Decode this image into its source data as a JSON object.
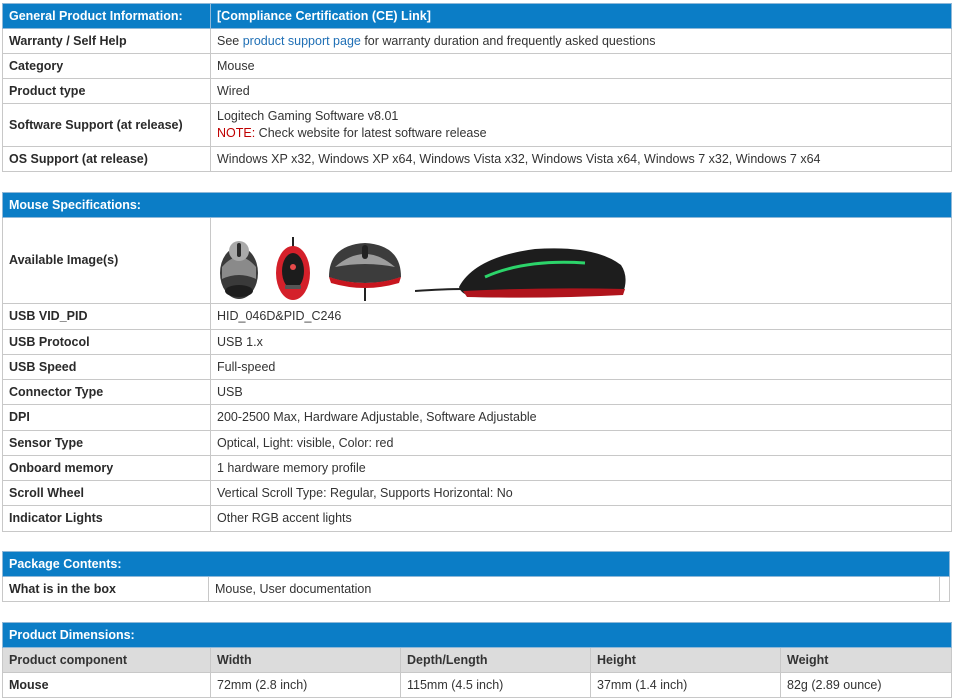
{
  "general": {
    "header_label": "General Product Information:",
    "header_link": "[Compliance Certification (CE) Link]",
    "rows": {
      "warranty": {
        "label": "Warranty / Self Help",
        "pre": "See ",
        "link": "product support page",
        "post": " for warranty duration and frequently asked questions"
      },
      "category": {
        "label": "Category",
        "value": "Mouse"
      },
      "product_type": {
        "label": "Product type",
        "value": "Wired"
      },
      "software": {
        "label": "Software Support (at release)",
        "value": "Logitech Gaming Software v8.01",
        "note_prefix": "NOTE:",
        "note_text": " Check website for latest software release"
      },
      "os": {
        "label": "OS Support (at release)",
        "value": "Windows XP x32, Windows XP x64, Windows Vista x32, Windows Vista x64, Windows 7 x32, Windows 7 x64"
      }
    }
  },
  "mouse_specs": {
    "header": "Mouse Specifications:",
    "images_label": "Available Image(s)",
    "images": [
      "mouse-front-image",
      "mouse-bottom-image",
      "mouse-top-image",
      "mouse-side-image"
    ],
    "rows": [
      {
        "label": "USB VID_PID",
        "value": "HID_046D&PID_C246"
      },
      {
        "label": "USB Protocol",
        "value": "USB 1.x"
      },
      {
        "label": "USB Speed",
        "value": "Full-speed"
      },
      {
        "label": "Connector Type",
        "value": "USB"
      },
      {
        "label": "DPI",
        "value": "200-2500 Max, Hardware Adjustable, Software Adjustable"
      },
      {
        "label": "Sensor Type",
        "value": "Optical, Light: visible, Color: red"
      },
      {
        "label": "Onboard memory",
        "value": "1 hardware memory profile"
      },
      {
        "label": "Scroll Wheel",
        "value": "Vertical Scroll Type: Regular, Supports Horizontal: No"
      },
      {
        "label": "Indicator Lights",
        "value": "Other RGB accent lights"
      }
    ]
  },
  "package": {
    "header": "Package Contents:",
    "label": "What is in the box",
    "value": "Mouse, User documentation"
  },
  "dimensions": {
    "header": "Product Dimensions:",
    "columns": [
      "Product component",
      "Width",
      "Depth/Length",
      "Height",
      "Weight"
    ],
    "row": [
      "Mouse",
      "72mm (2.8 inch)",
      "115mm (4.5 inch)",
      "37mm (1.4 inch)",
      "82g (2.89 ounce)"
    ]
  },
  "colors": {
    "header_bg": "#0b7dc6",
    "subheader_bg": "#dcdcdc",
    "border": "#c8c8c8",
    "link": "#1f6fb5",
    "note": "#c00000"
  }
}
